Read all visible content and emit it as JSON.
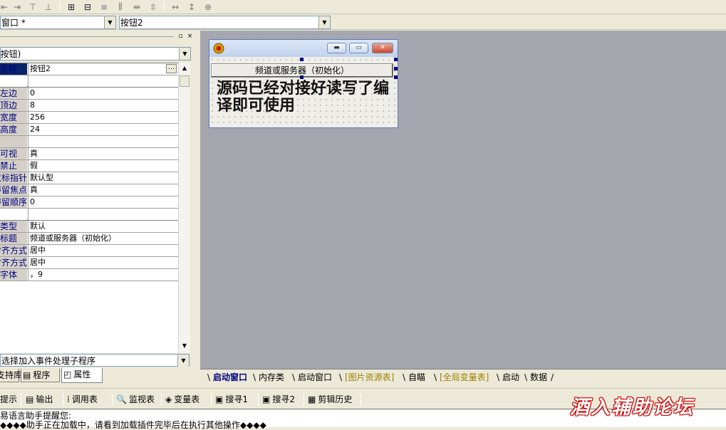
{
  "toolbar": {
    "buttons": [
      "align-left-icon",
      "align-center-h-icon",
      "distribute-v-icon",
      "distribute-h-icon",
      "center-h-icon",
      "center-v-icon",
      "align-top-icon",
      "space-equal-h-icon",
      "space-equal-h2-icon",
      "space-equal-v-icon",
      "same-width-icon",
      "same-height-icon",
      "same-size-icon"
    ]
  },
  "combos": {
    "window": "窗口 *",
    "component": "按钮2",
    "object": "(按钮)",
    "event": "选择加入事件处理子程序"
  },
  "properties": [
    {
      "name": "名称",
      "value": "按钮2",
      "selected": true,
      "ellipsis": true
    },
    {
      "name": "",
      "value": "",
      "group": true
    },
    {
      "name": "左边",
      "value": "0"
    },
    {
      "name": "顶边",
      "value": "8"
    },
    {
      "name": "宽度",
      "value": "256"
    },
    {
      "name": "高度",
      "value": "24"
    },
    {
      "name": "",
      "value": ""
    },
    {
      "name": "可视",
      "value": "真"
    },
    {
      "name": "禁止",
      "value": "假"
    },
    {
      "name": "鼠标指针",
      "value": "默认型"
    },
    {
      "name": "可停留焦点",
      "value": "真"
    },
    {
      "name": "停留顺序",
      "value": "0"
    },
    {
      "name": "",
      "value": "",
      "group": true
    },
    {
      "name": "类型",
      "value": "默认"
    },
    {
      "name": "标题",
      "value": "频道或服务器（初始化）"
    },
    {
      "name": "横向对齐方式",
      "value": "居中"
    },
    {
      "name": "纵向对齐方式",
      "value": "居中"
    },
    {
      "name": "字体",
      "value": "，9"
    }
  ],
  "left_tabs": [
    {
      "label": "支持库",
      "icon": "library-icon"
    },
    {
      "label": "程序",
      "icon": "program-icon"
    },
    {
      "label": "属性",
      "icon": "property-icon",
      "active": true
    }
  ],
  "form": {
    "button_label": "频道或服务器（初始化）",
    "label_text": "源码已经对接好读写了编译即可使用",
    "logo": "e-logo"
  },
  "code_tabs": [
    {
      "label": "启动窗口",
      "active": true
    },
    {
      "label": "内存类"
    },
    {
      "label": "启动窗口"
    },
    {
      "label": "[图片资源表]",
      "gold": true
    },
    {
      "label": "自瞄"
    },
    {
      "label": "[全局变量表]",
      "gold": true
    },
    {
      "label": "启动"
    },
    {
      "label": "数据"
    }
  ],
  "bottom_tabs": [
    {
      "label": "提示"
    },
    {
      "label": "输出",
      "icon": "output-icon"
    },
    {
      "label": "调用表",
      "icon": "call-table-icon"
    },
    {
      "label": "监视表",
      "icon": "magnifier-icon"
    },
    {
      "label": "变量表",
      "icon": "variable-icon"
    },
    {
      "label": "搜寻1",
      "icon": "search1-icon"
    },
    {
      "label": "搜寻2",
      "icon": "search2-icon"
    },
    {
      "label": "剪辑历史",
      "icon": "clipboard-icon"
    }
  ],
  "output": {
    "line1": "易语言助手提醒您:",
    "line2": "◆◆◆◆助手正在加载中，请看到加载插件完毕后在执行其他操作◆◆◆◆"
  },
  "watermark": "酒入辅助论坛"
}
